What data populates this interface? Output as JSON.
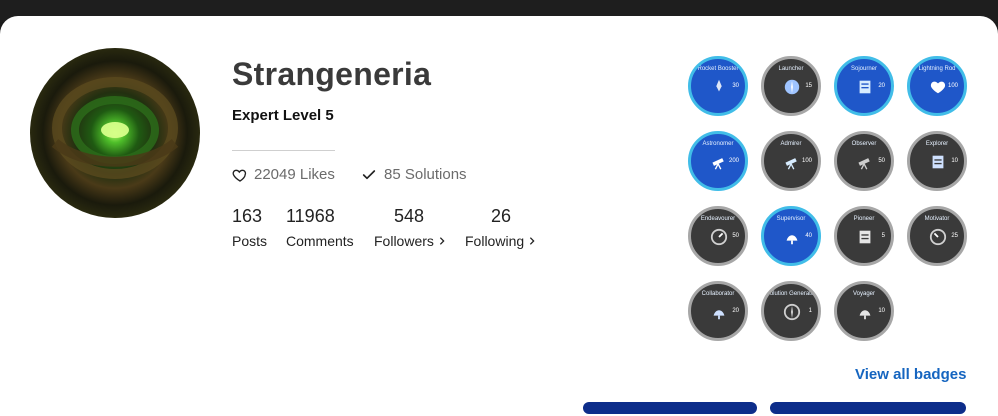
{
  "profile": {
    "name": "Strangeneria",
    "level": "Expert Level 5",
    "likes": "22049 Likes",
    "solutions": "85 Solutions",
    "stats": [
      {
        "value": "163",
        "label": "Posts"
      },
      {
        "value": "11968",
        "label": "Comments"
      },
      {
        "value": "548",
        "label": "Followers"
      },
      {
        "value": "26",
        "label": "Following"
      }
    ]
  },
  "badges": [
    {
      "name": "Rocket Booster",
      "count": "30",
      "style": "blue"
    },
    {
      "name": "Launcher",
      "count": "15",
      "style": "gray"
    },
    {
      "name": "Sojourner",
      "count": "20",
      "style": "blue"
    },
    {
      "name": "Lightning Rod",
      "count": "100",
      "style": "blue"
    },
    {
      "name": "Astronomer",
      "count": "200",
      "style": "blue"
    },
    {
      "name": "Admirer",
      "count": "100",
      "style": "gray"
    },
    {
      "name": "Observer",
      "count": "50",
      "style": "gray"
    },
    {
      "name": "Explorer",
      "count": "10",
      "style": "gray"
    },
    {
      "name": "Endeavourer",
      "count": "50",
      "style": "gray"
    },
    {
      "name": "Supervisor",
      "count": "40",
      "style": "blue"
    },
    {
      "name": "Pioneer",
      "count": "5",
      "style": "gray"
    },
    {
      "name": "Motivator",
      "count": "25",
      "style": "gray"
    },
    {
      "name": "Collaborator",
      "count": "20",
      "style": "gray"
    },
    {
      "name": "Solution Generator",
      "count": "1",
      "style": "gray"
    },
    {
      "name": "Voyager",
      "count": "10",
      "style": "gray"
    }
  ],
  "view_all_label": "View all badges",
  "icons": {
    "likes": "heart-icon",
    "solutions": "check-icon",
    "more": "chevron-right-icon"
  },
  "colors": {
    "accent": "#1565c0",
    "badge_blue": "#1f57c9",
    "badge_gray": "#3a3a3a"
  }
}
